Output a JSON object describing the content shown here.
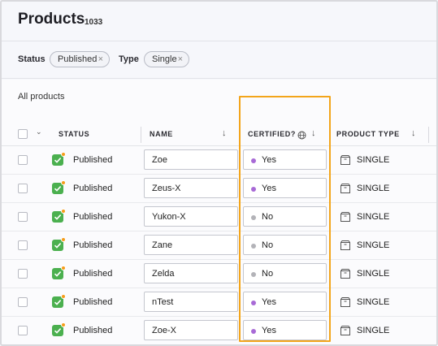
{
  "page": {
    "title": "Products",
    "count": "1033"
  },
  "filters": [
    {
      "label": "Status",
      "value": "Published"
    },
    {
      "label": "Type",
      "value": "Single"
    }
  ],
  "section_title": "All products",
  "columns": {
    "status": "STATUS",
    "name": "NAME",
    "certified": "CERTIFIED?",
    "product_type": "PRODUCT TYPE"
  },
  "colors": {
    "accent_highlight": "#f3a51b",
    "certified_yes": "#a86ad6",
    "certified_no": "#b3b3b8",
    "status_green": "#4bb04f",
    "status_badge": "#f59c1a"
  },
  "rows": [
    {
      "status": "Published",
      "name": "Zoe",
      "certified": "Yes",
      "type": "SINGLE"
    },
    {
      "status": "Published",
      "name": "Zeus-X",
      "certified": "Yes",
      "type": "SINGLE"
    },
    {
      "status": "Published",
      "name": "Yukon-X",
      "certified": "No",
      "type": "SINGLE"
    },
    {
      "status": "Published",
      "name": "Zane",
      "certified": "No",
      "type": "SINGLE"
    },
    {
      "status": "Published",
      "name": "Zelda",
      "certified": "No",
      "type": "SINGLE"
    },
    {
      "status": "Published",
      "name": "nTest",
      "certified": "Yes",
      "type": "SINGLE"
    },
    {
      "status": "Published",
      "name": "Zoe-X",
      "certified": "Yes",
      "type": "SINGLE"
    }
  ]
}
